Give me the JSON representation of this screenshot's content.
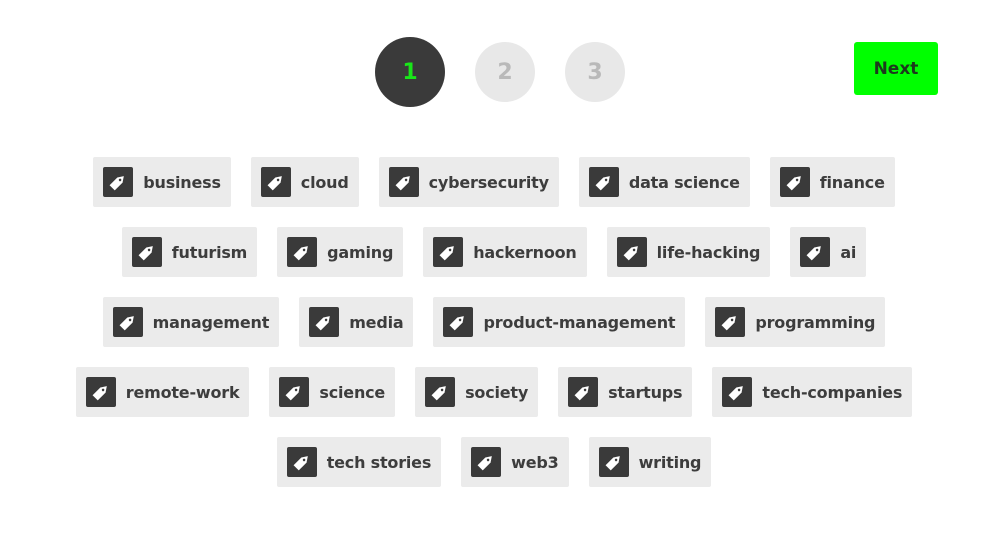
{
  "steps": [
    {
      "label": "1",
      "state": "active"
    },
    {
      "label": "2",
      "state": "inactive"
    },
    {
      "label": "3",
      "state": "inactive"
    }
  ],
  "next_button": {
    "label": "Next"
  },
  "colors": {
    "accent": "#00ff00",
    "active_step_bg": "#3a3a3a",
    "tag_bg": "#ebebeb"
  },
  "tag_icon": "price-tag-icon",
  "tag_rows": [
    [
      "business",
      "cloud",
      "cybersecurity",
      "data science",
      "finance"
    ],
    [
      "futurism",
      "gaming",
      "hackernoon",
      "life-hacking",
      "ai"
    ],
    [
      "management",
      "media",
      "product-management",
      "programming"
    ],
    [
      "remote-work",
      "science",
      "society",
      "startups",
      "tech-companies"
    ],
    [
      "tech stories",
      "web3",
      "writing"
    ]
  ]
}
